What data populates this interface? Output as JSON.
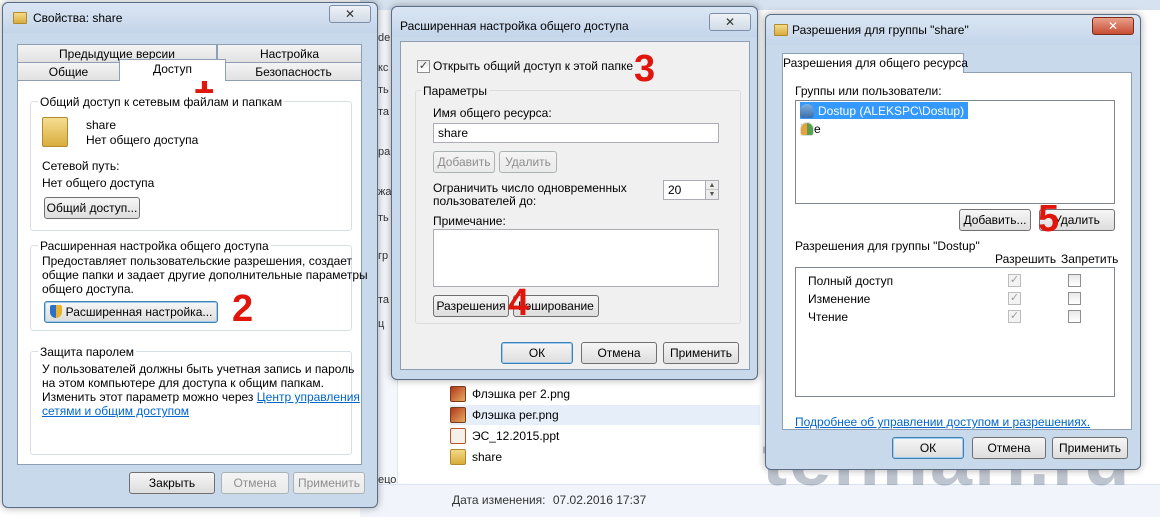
{
  "explorer": {
    "nav_fragments": [
      "de",
      "кс",
      "ть",
      "та",
      "ра",
      "жа",
      "ть",
      "гр",
      "та",
      "ц",
      "ецо",
      "Пр"
    ],
    "files": [
      {
        "name": "Флэшка рег 2.png",
        "icon": "png-file-icon"
      },
      {
        "name": "Флэшка рег.png",
        "icon": "png-file-icon"
      },
      {
        "name": "ЭС_12.2015.ppt",
        "icon": "ppt-file-icon"
      },
      {
        "name": "share",
        "icon": "folder-icon"
      }
    ],
    "status_label": "Дата изменения:",
    "status_value": "07.02.2016 17:37"
  },
  "props": {
    "title": "Свойства: share",
    "close_glyph": "✕",
    "tabs_row1": [
      "Предыдущие версии",
      "Настройка"
    ],
    "tabs_row2": [
      "Общие",
      "Доступ",
      "Безопасность"
    ],
    "net_group_title": "Общий доступ к сетевым файлам и папкам",
    "folder_name": "share",
    "folder_status": "Нет общего доступа",
    "net_path_label": "Сетевой путь:",
    "net_path_value": "Нет общего доступа",
    "share_button": "Общий доступ...",
    "adv_group_title": "Расширенная настройка общего доступа",
    "adv_desc_lines": [
      "Предоставляет пользовательские разрешения, создает",
      "общие папки и задает другие дополнительные параметры",
      "общего доступа."
    ],
    "adv_button": "Расширенная настройка...",
    "pwd_group_title": "Защита паролем",
    "pwd_lines": [
      "У пользователей должны быть учетная запись и пароль",
      "на этом компьютере для доступа к общим папкам.",
      "Изменить этот параметр можно через "
    ],
    "pwd_link_a": "Центр управления",
    "pwd_link_b": "сетями и общим доступом",
    "btn_close": "Закрыть",
    "btn_cancel": "Отмена",
    "btn_apply": "Применить"
  },
  "adv": {
    "title": "Расширенная настройка общего доступа",
    "close_glyph": "✕",
    "share_check_label": "Открыть общий доступ к этой папке",
    "share_checked": true,
    "params_title": "Параметры",
    "share_name_label": "Имя общего ресурса:",
    "share_name_value": "share",
    "btn_add": "Добавить",
    "btn_remove": "Удалить",
    "limit_label_1": "Ограничить число одновременных",
    "limit_label_2": "пользователей до:",
    "limit_value": "20",
    "comment_label": "Примечание:",
    "btn_permissions": "Разрешения",
    "btn_caching": "Кэширование",
    "btn_ok": "ОК",
    "btn_cancel": "Отмена",
    "btn_apply": "Применить"
  },
  "perm": {
    "title": "Разрешения для группы \"share\"",
    "close_glyph": "✕",
    "tab": "Разрешения для общего ресурса",
    "users_label": "Группы или пользователи:",
    "users": [
      {
        "name": "Dostup (ALEKSPC\\Dostup)",
        "icon": "user-icon",
        "selected": true
      },
      {
        "name": "Все",
        "icon": "users-group-icon",
        "selected": false
      }
    ],
    "btn_add": "Добавить...",
    "btn_remove": "Удалить",
    "btn_remove_visible": "Удалить",
    "perms_label": "Разрешения для группы \"Dostup\"",
    "col_allow": "Разрешить",
    "col_deny": "Запретить",
    "rows": [
      {
        "name": "Полный доступ",
        "allow": true,
        "deny": false
      },
      {
        "name": "Изменение",
        "allow": true,
        "deny": false
      },
      {
        "name": "Чтение",
        "allow": true,
        "deny": false
      }
    ],
    "link": "Подробнее об управлении доступом и разрешениях.",
    "btn_ok": "ОК",
    "btn_cancel": "Отмена",
    "btn_apply": "Применить"
  },
  "annotations": [
    "1",
    "2",
    "3",
    "4",
    "5"
  ],
  "watermark": "tehnari.ru",
  "check_glyph": "✓",
  "colors": {
    "annotation_red": "#e0160d",
    "selection_blue": "#3399ff",
    "link_blue": "#0066cc",
    "window_frame": "#c9d9ec"
  }
}
